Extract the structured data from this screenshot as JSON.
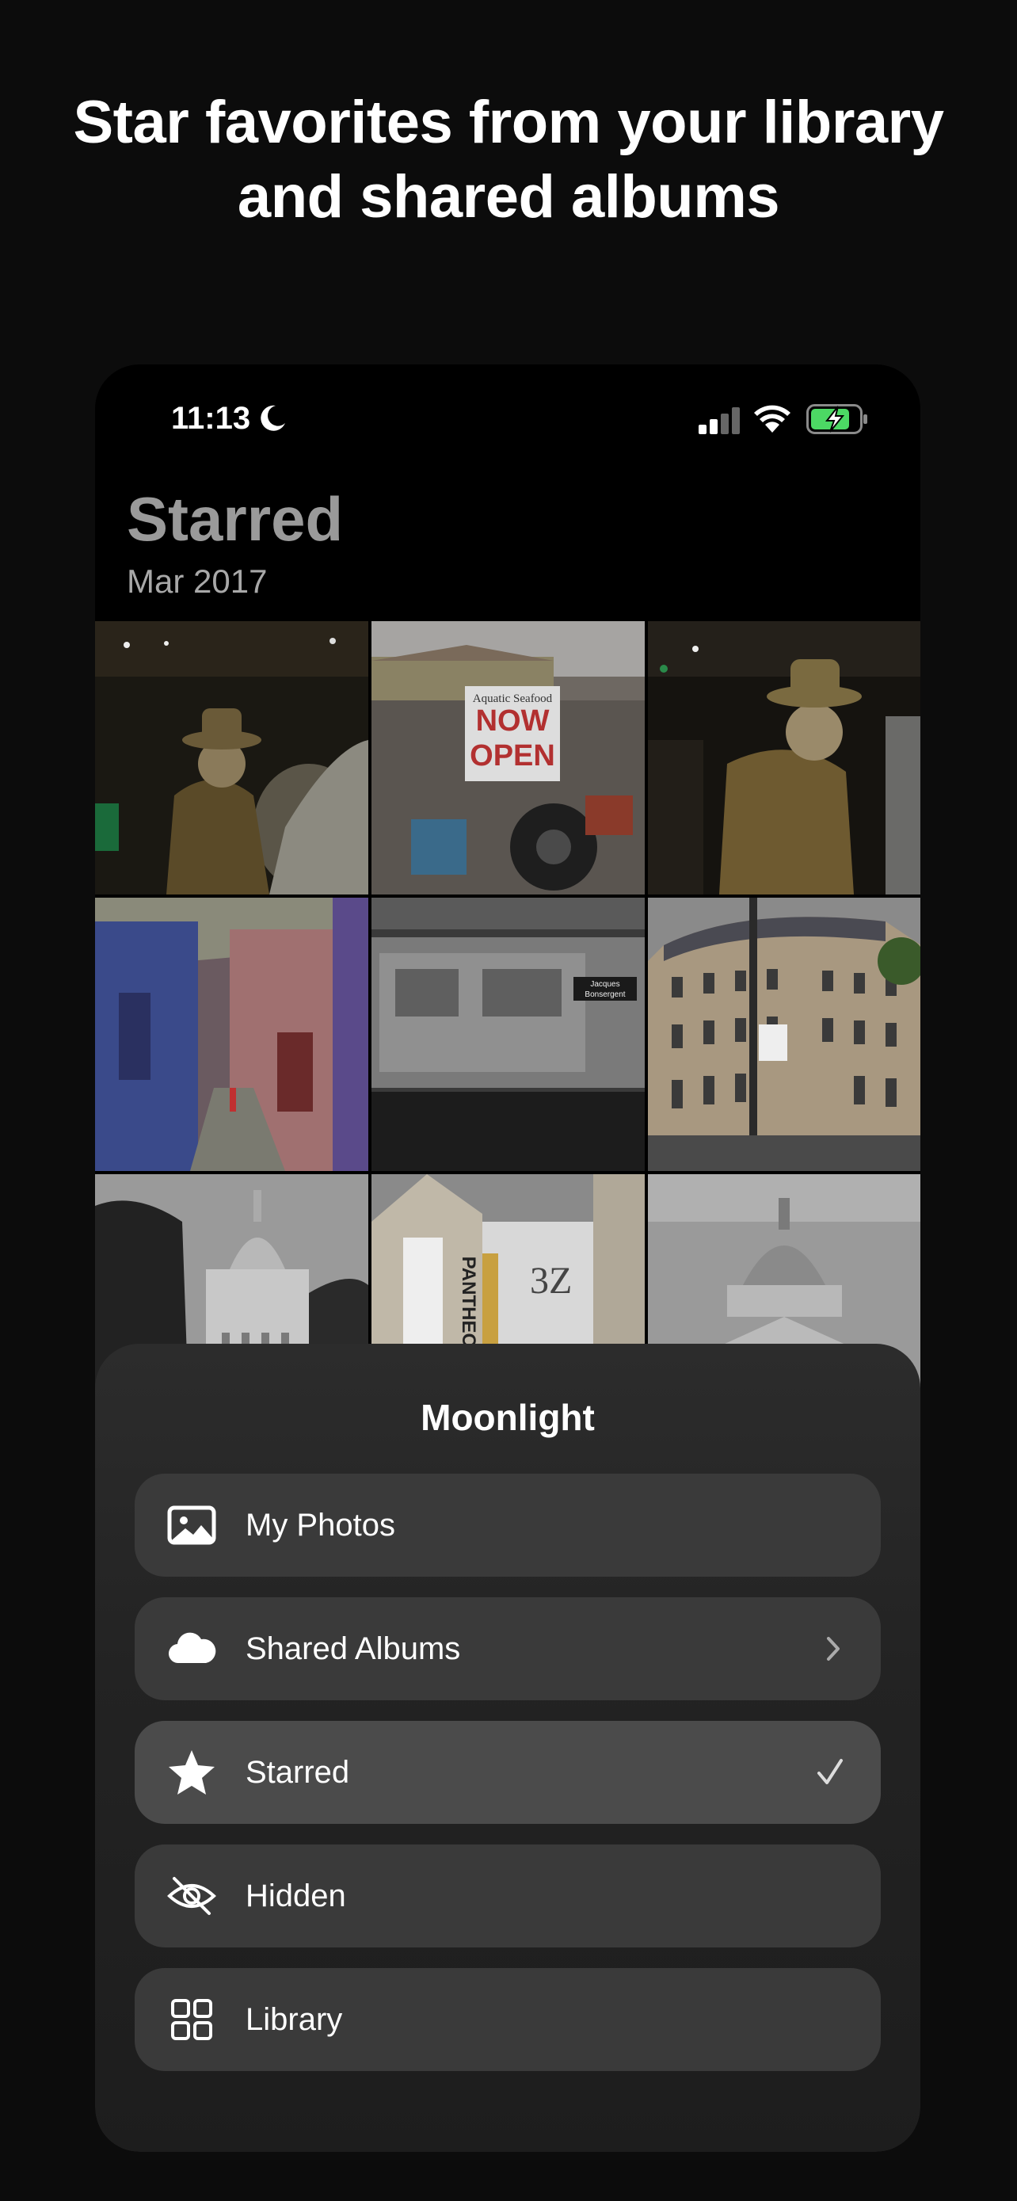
{
  "headline": {
    "line1": "Star favorites from your library",
    "line2": "and shared albums"
  },
  "status_bar": {
    "time": "11:13",
    "icons": [
      "moon-icon",
      "cellular-signal-icon",
      "wifi-icon",
      "battery-charging-icon"
    ],
    "battery_color": "#4cd964"
  },
  "page": {
    "title": "Starred",
    "subtitle": "Mar 2017"
  },
  "photos": [
    {
      "name": "man-in-hat-subway"
    },
    {
      "name": "seafood-shop-now-open",
      "sign_top": "Aquatic Seafood",
      "sign_main": "NOW OPEN"
    },
    {
      "name": "man-in-hat-subway-zoom"
    },
    {
      "name": "colorful-street"
    },
    {
      "name": "metro-train-motion",
      "sign": "Jacques Bonsergent"
    },
    {
      "name": "paris-building-corner"
    },
    {
      "name": "church-dome"
    },
    {
      "name": "pantheon-theater-sign"
    },
    {
      "name": "pantheon-dome"
    }
  ],
  "sheet": {
    "title": "Moonlight",
    "items": [
      {
        "label": "My Photos",
        "icon": "photo-icon",
        "trail": ""
      },
      {
        "label": "Shared Albums",
        "icon": "cloud-icon",
        "trail": "chevron-right-icon"
      },
      {
        "label": "Starred",
        "icon": "star-icon",
        "trail": "checkmark-icon",
        "selected": true
      },
      {
        "label": "Hidden",
        "icon": "eye-slash-icon",
        "trail": ""
      },
      {
        "label": "Library",
        "icon": "grid-icon",
        "trail": ""
      }
    ]
  }
}
